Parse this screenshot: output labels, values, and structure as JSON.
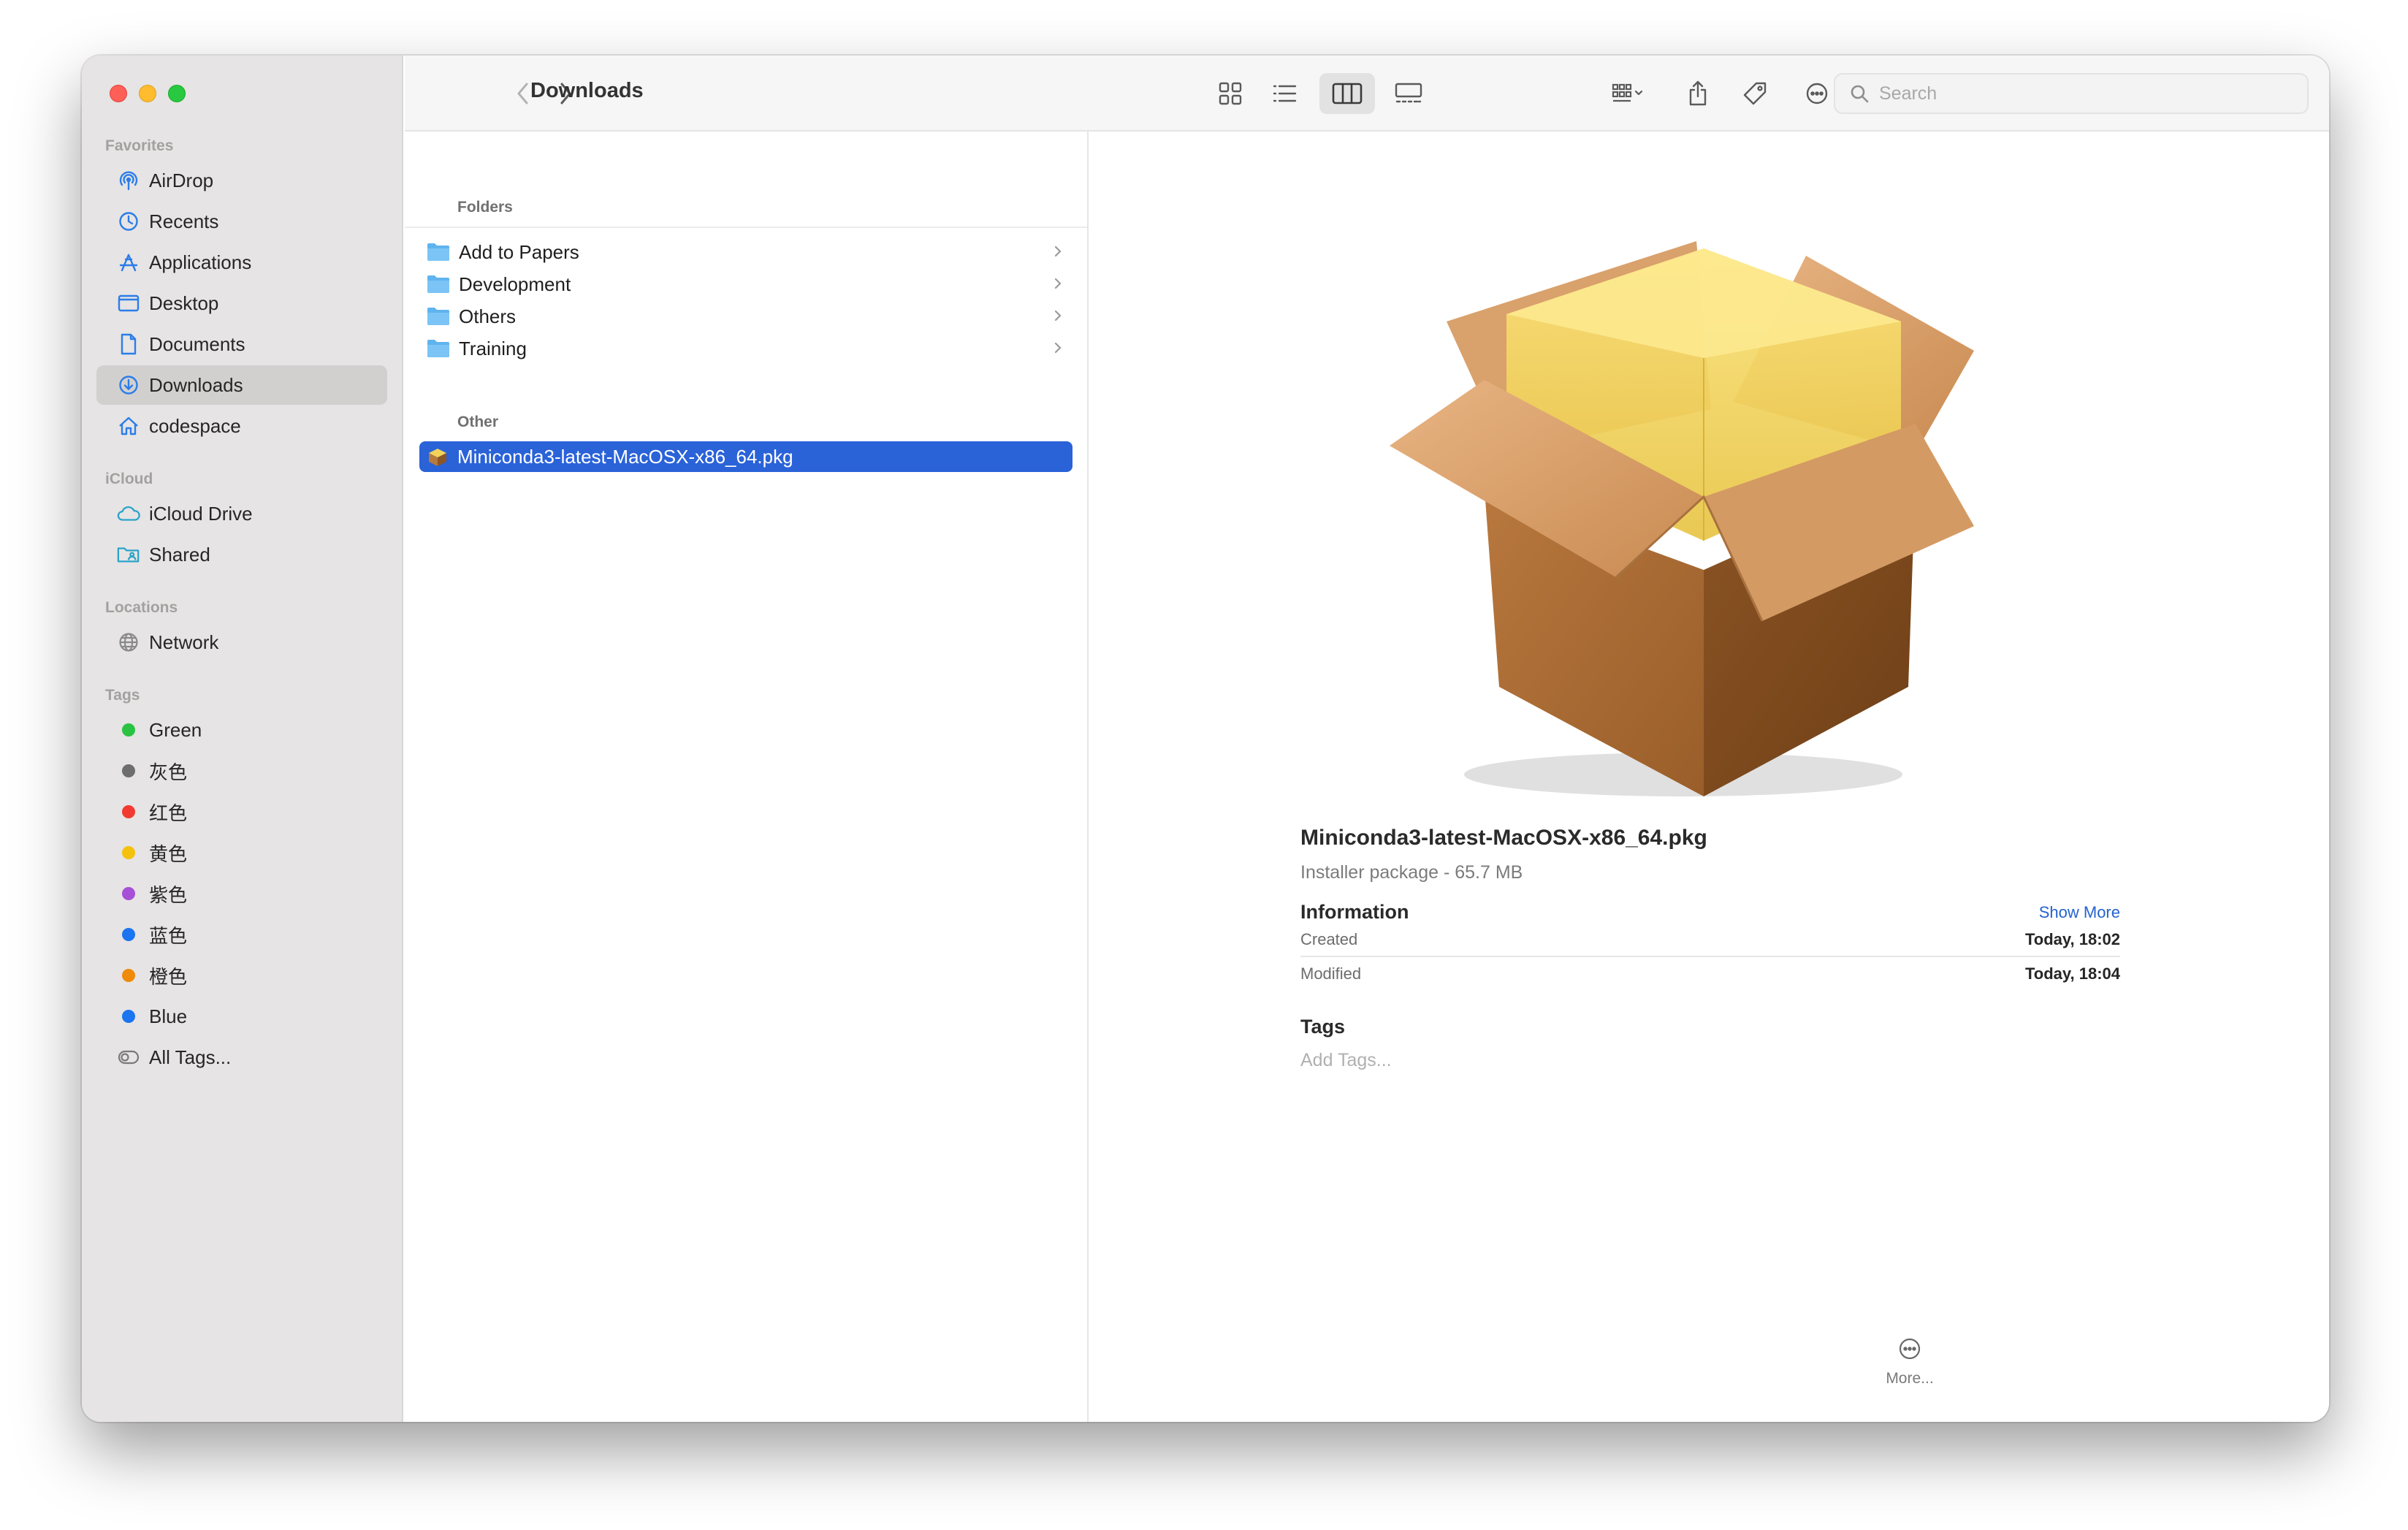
{
  "window": {
    "title": "Downloads"
  },
  "sidebar": {
    "favorites_label": "Favorites",
    "favorites": [
      {
        "label": "AirDrop",
        "icon": "airdrop-icon"
      },
      {
        "label": "Recents",
        "icon": "clock-icon"
      },
      {
        "label": "Applications",
        "icon": "applications-icon"
      },
      {
        "label": "Desktop",
        "icon": "desktop-icon"
      },
      {
        "label": "Documents",
        "icon": "document-icon"
      },
      {
        "label": "Downloads",
        "icon": "download-icon",
        "selected": true
      },
      {
        "label": "codespace",
        "icon": "home-icon"
      }
    ],
    "icloud_label": "iCloud",
    "icloud": [
      {
        "label": "iCloud Drive",
        "icon": "cloud-icon"
      },
      {
        "label": "Shared",
        "icon": "shared-folder-icon"
      }
    ],
    "locations_label": "Locations",
    "locations": [
      {
        "label": "Network",
        "icon": "globe-icon"
      }
    ],
    "tags_label": "Tags",
    "tags": [
      {
        "label": "Green",
        "color": "#2ac341"
      },
      {
        "label": "灰色",
        "color": "#6e6e6e"
      },
      {
        "label": "红色",
        "color": "#f23b30"
      },
      {
        "label": "黄色",
        "color": "#f4c20d"
      },
      {
        "label": "紫色",
        "color": "#a550d6"
      },
      {
        "label": "蓝色",
        "color": "#1b74f0"
      },
      {
        "label": "橙色",
        "color": "#f08a0b"
      },
      {
        "label": "Blue",
        "color": "#1b74f0"
      },
      {
        "label": "All Tags...",
        "icon": "all-tags-icon"
      }
    ]
  },
  "toolbar": {
    "search_placeholder": "Search"
  },
  "column": {
    "folders_heading": "Folders",
    "folders": [
      "Add to Papers",
      "Development",
      "Others",
      "Training"
    ],
    "other_heading": "Other",
    "files": [
      {
        "label": "Miniconda3-latest-MacOSX-x86_64.pkg",
        "icon": "package-icon",
        "selected": true
      }
    ]
  },
  "preview": {
    "file_name": "Miniconda3-latest-MacOSX-x86_64.pkg",
    "file_kind": "Installer package - 65.7 MB",
    "information_label": "Information",
    "show_more": "Show More",
    "created_label": "Created",
    "created_value": "Today, 18:02",
    "modified_label": "Modified",
    "modified_value": "Today, 18:04",
    "tags_label": "Tags",
    "add_tags": "Add Tags...",
    "more_label": "More..."
  },
  "colors": {
    "accent": "#2a62d8",
    "sidebar_bg": "#e6e4e4",
    "sidebar_icon": "#2b7de9"
  }
}
